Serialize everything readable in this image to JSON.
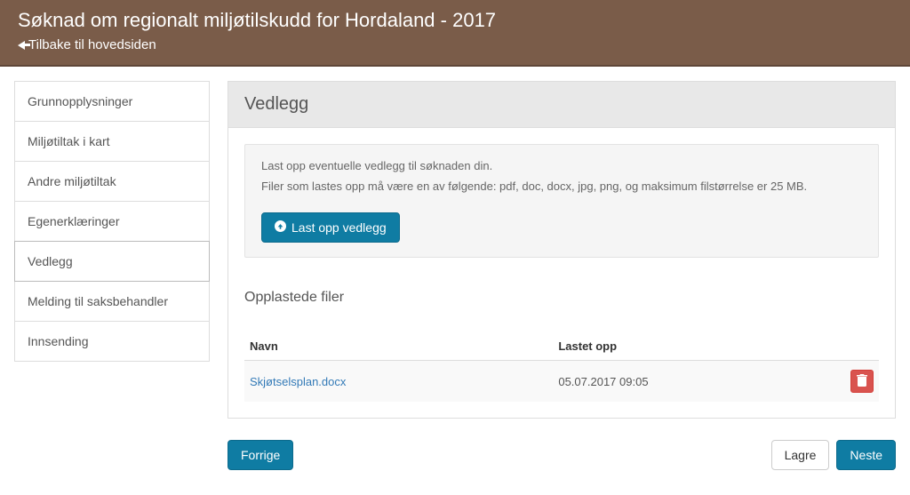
{
  "header": {
    "title": "Søknad om regionalt miljøtilskudd for Hordaland - 2017",
    "back_label": "Tilbake til hovedsiden"
  },
  "sidebar": {
    "items": [
      {
        "label": "Grunnopplysninger"
      },
      {
        "label": "Miljøtiltak i kart"
      },
      {
        "label": "Andre miljøtiltak"
      },
      {
        "label": "Egenerklæringer"
      },
      {
        "label": "Vedlegg"
      },
      {
        "label": "Melding til saksbehandler"
      },
      {
        "label": "Innsending"
      }
    ],
    "active_index": 4
  },
  "panel": {
    "heading": "Vedlegg",
    "instructions_line1": "Last opp eventuelle vedlegg til søknaden din.",
    "instructions_line2": "Filer som lastes opp må være en av følgende: pdf, doc, docx, jpg, png, og maksimum filstørrelse er 25 MB.",
    "upload_button": "Last opp vedlegg"
  },
  "uploaded": {
    "heading": "Opplastede filer",
    "columns": {
      "name": "Navn",
      "uploaded": "Lastet opp"
    },
    "files": [
      {
        "name": "Skjøtselsplan.docx",
        "uploaded": "05.07.2017 09:05"
      }
    ]
  },
  "footer": {
    "previous": "Forrige",
    "save": "Lagre",
    "next": "Neste"
  }
}
